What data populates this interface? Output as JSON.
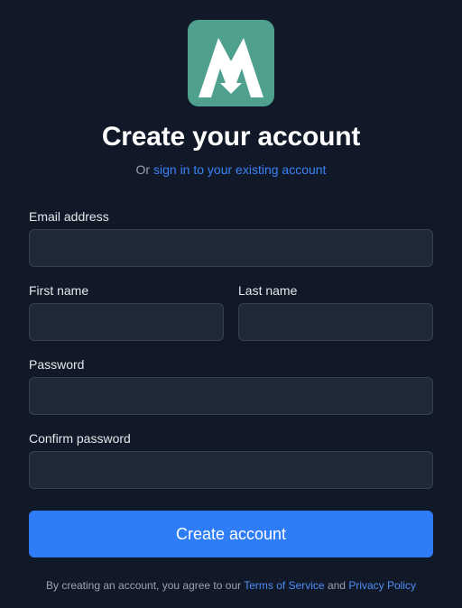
{
  "brand": {
    "logo_icon": "mountain-m-logo",
    "logo_color": "#4fa08e"
  },
  "header": {
    "title": "Create your account",
    "subtitle_prefix": "Or",
    "signin_link": "sign in to your existing account"
  },
  "form": {
    "email": {
      "label": "Email address",
      "value": "",
      "placeholder": ""
    },
    "first_name": {
      "label": "First name",
      "value": "",
      "placeholder": ""
    },
    "last_name": {
      "label": "Last name",
      "value": "",
      "placeholder": ""
    },
    "password": {
      "label": "Password",
      "value": "",
      "placeholder": ""
    },
    "confirm_password": {
      "label": "Confirm password",
      "value": "",
      "placeholder": ""
    },
    "submit_label": "Create account"
  },
  "footer": {
    "legal_prefix": "By creating an account, you agree to our",
    "terms_link": "Terms of Service",
    "conjunction": "and",
    "privacy_link": "Privacy Policy"
  },
  "colors": {
    "background": "#111827",
    "input_bg": "#1f2937",
    "accent": "#2e7df7",
    "link": "#3b82f6"
  }
}
